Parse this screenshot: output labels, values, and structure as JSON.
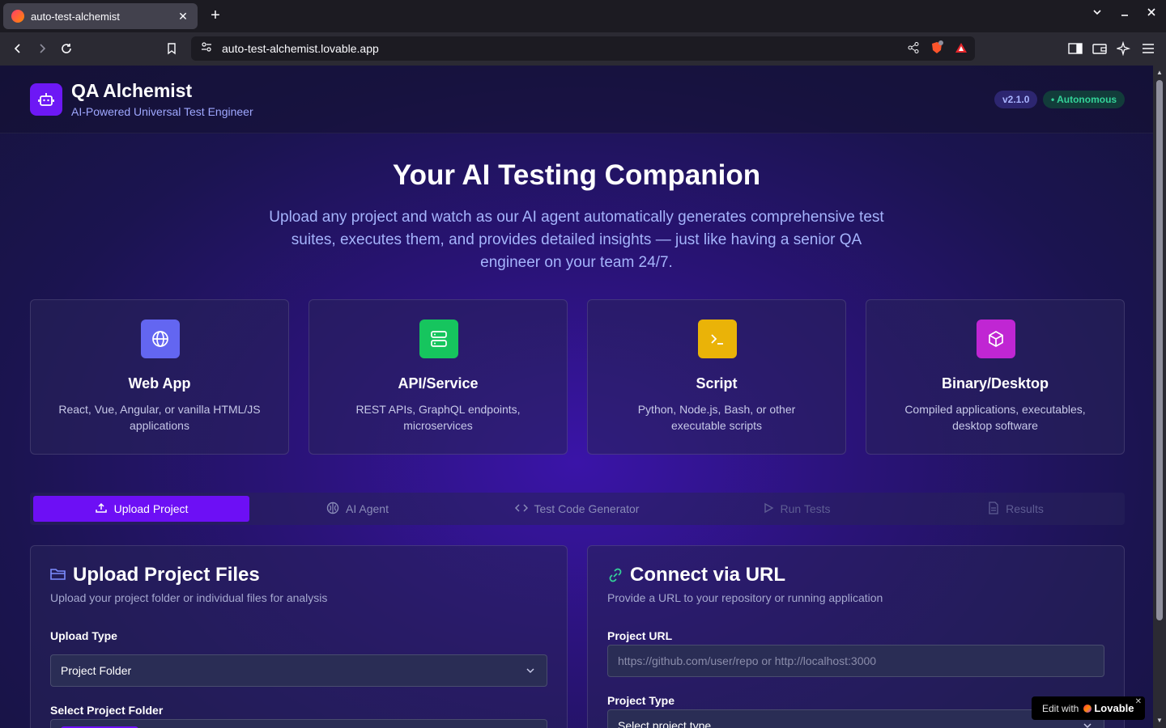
{
  "browser": {
    "tab_title": "auto-test-alchemist",
    "url": "auto-test-alchemist.lovable.app",
    "new_tab": "+",
    "close": "✕",
    "min": "—",
    "win_close": "✕",
    "win_list": "⌄"
  },
  "header": {
    "title": "QA Alchemist",
    "subtitle": "AI-Powered Universal Test Engineer",
    "version": "v2.1.0",
    "status": "• Autonomous"
  },
  "hero": {
    "title": "Your AI Testing Companion",
    "description": "Upload any project and watch as our AI agent automatically generates comprehensive test suites, executes them, and provides detailed insights — just like having a senior QA engineer on your team 24/7."
  },
  "cards": [
    {
      "title": "Web App",
      "desc": "React, Vue, Angular, or vanilla HTML/JS applications",
      "icon": "globe-icon",
      "color": "#6366f1"
    },
    {
      "title": "API/Service",
      "desc": "REST APIs, GraphQL endpoints, microservices",
      "icon": "server-icon",
      "color": "#16c55e"
    },
    {
      "title": "Script",
      "desc": "Python, Node.js, Bash, or other executable scripts",
      "icon": "terminal-icon",
      "color": "#eab308"
    },
    {
      "title": "Binary/Desktop",
      "desc": "Compiled applications, executables, desktop software",
      "icon": "package-icon",
      "color": "#c026d3"
    }
  ],
  "tabs": [
    {
      "label": "Upload Project",
      "icon": "upload-icon"
    },
    {
      "label": "AI Agent",
      "icon": "brain-icon"
    },
    {
      "label": "Test Code Generator",
      "icon": "code-icon"
    },
    {
      "label": "Run Tests",
      "icon": "play-icon"
    },
    {
      "label": "Results",
      "icon": "file-icon"
    }
  ],
  "upload_panel": {
    "title": "Upload Project Files",
    "subtitle": "Upload your project folder or individual files for analysis",
    "upload_type_label": "Upload Type",
    "upload_type_value": "Project Folder",
    "folder_label": "Select Project Folder"
  },
  "url_panel": {
    "title": "Connect via URL",
    "subtitle": "Provide a URL to your repository or running application",
    "url_label": "Project URL",
    "url_placeholder": "https://github.com/user/repo or http://localhost:3000",
    "type_label": "Project Type",
    "type_value": "Select project type"
  },
  "lovable": {
    "prefix": "Edit with",
    "brand": "Lovable",
    "close": "✕"
  }
}
